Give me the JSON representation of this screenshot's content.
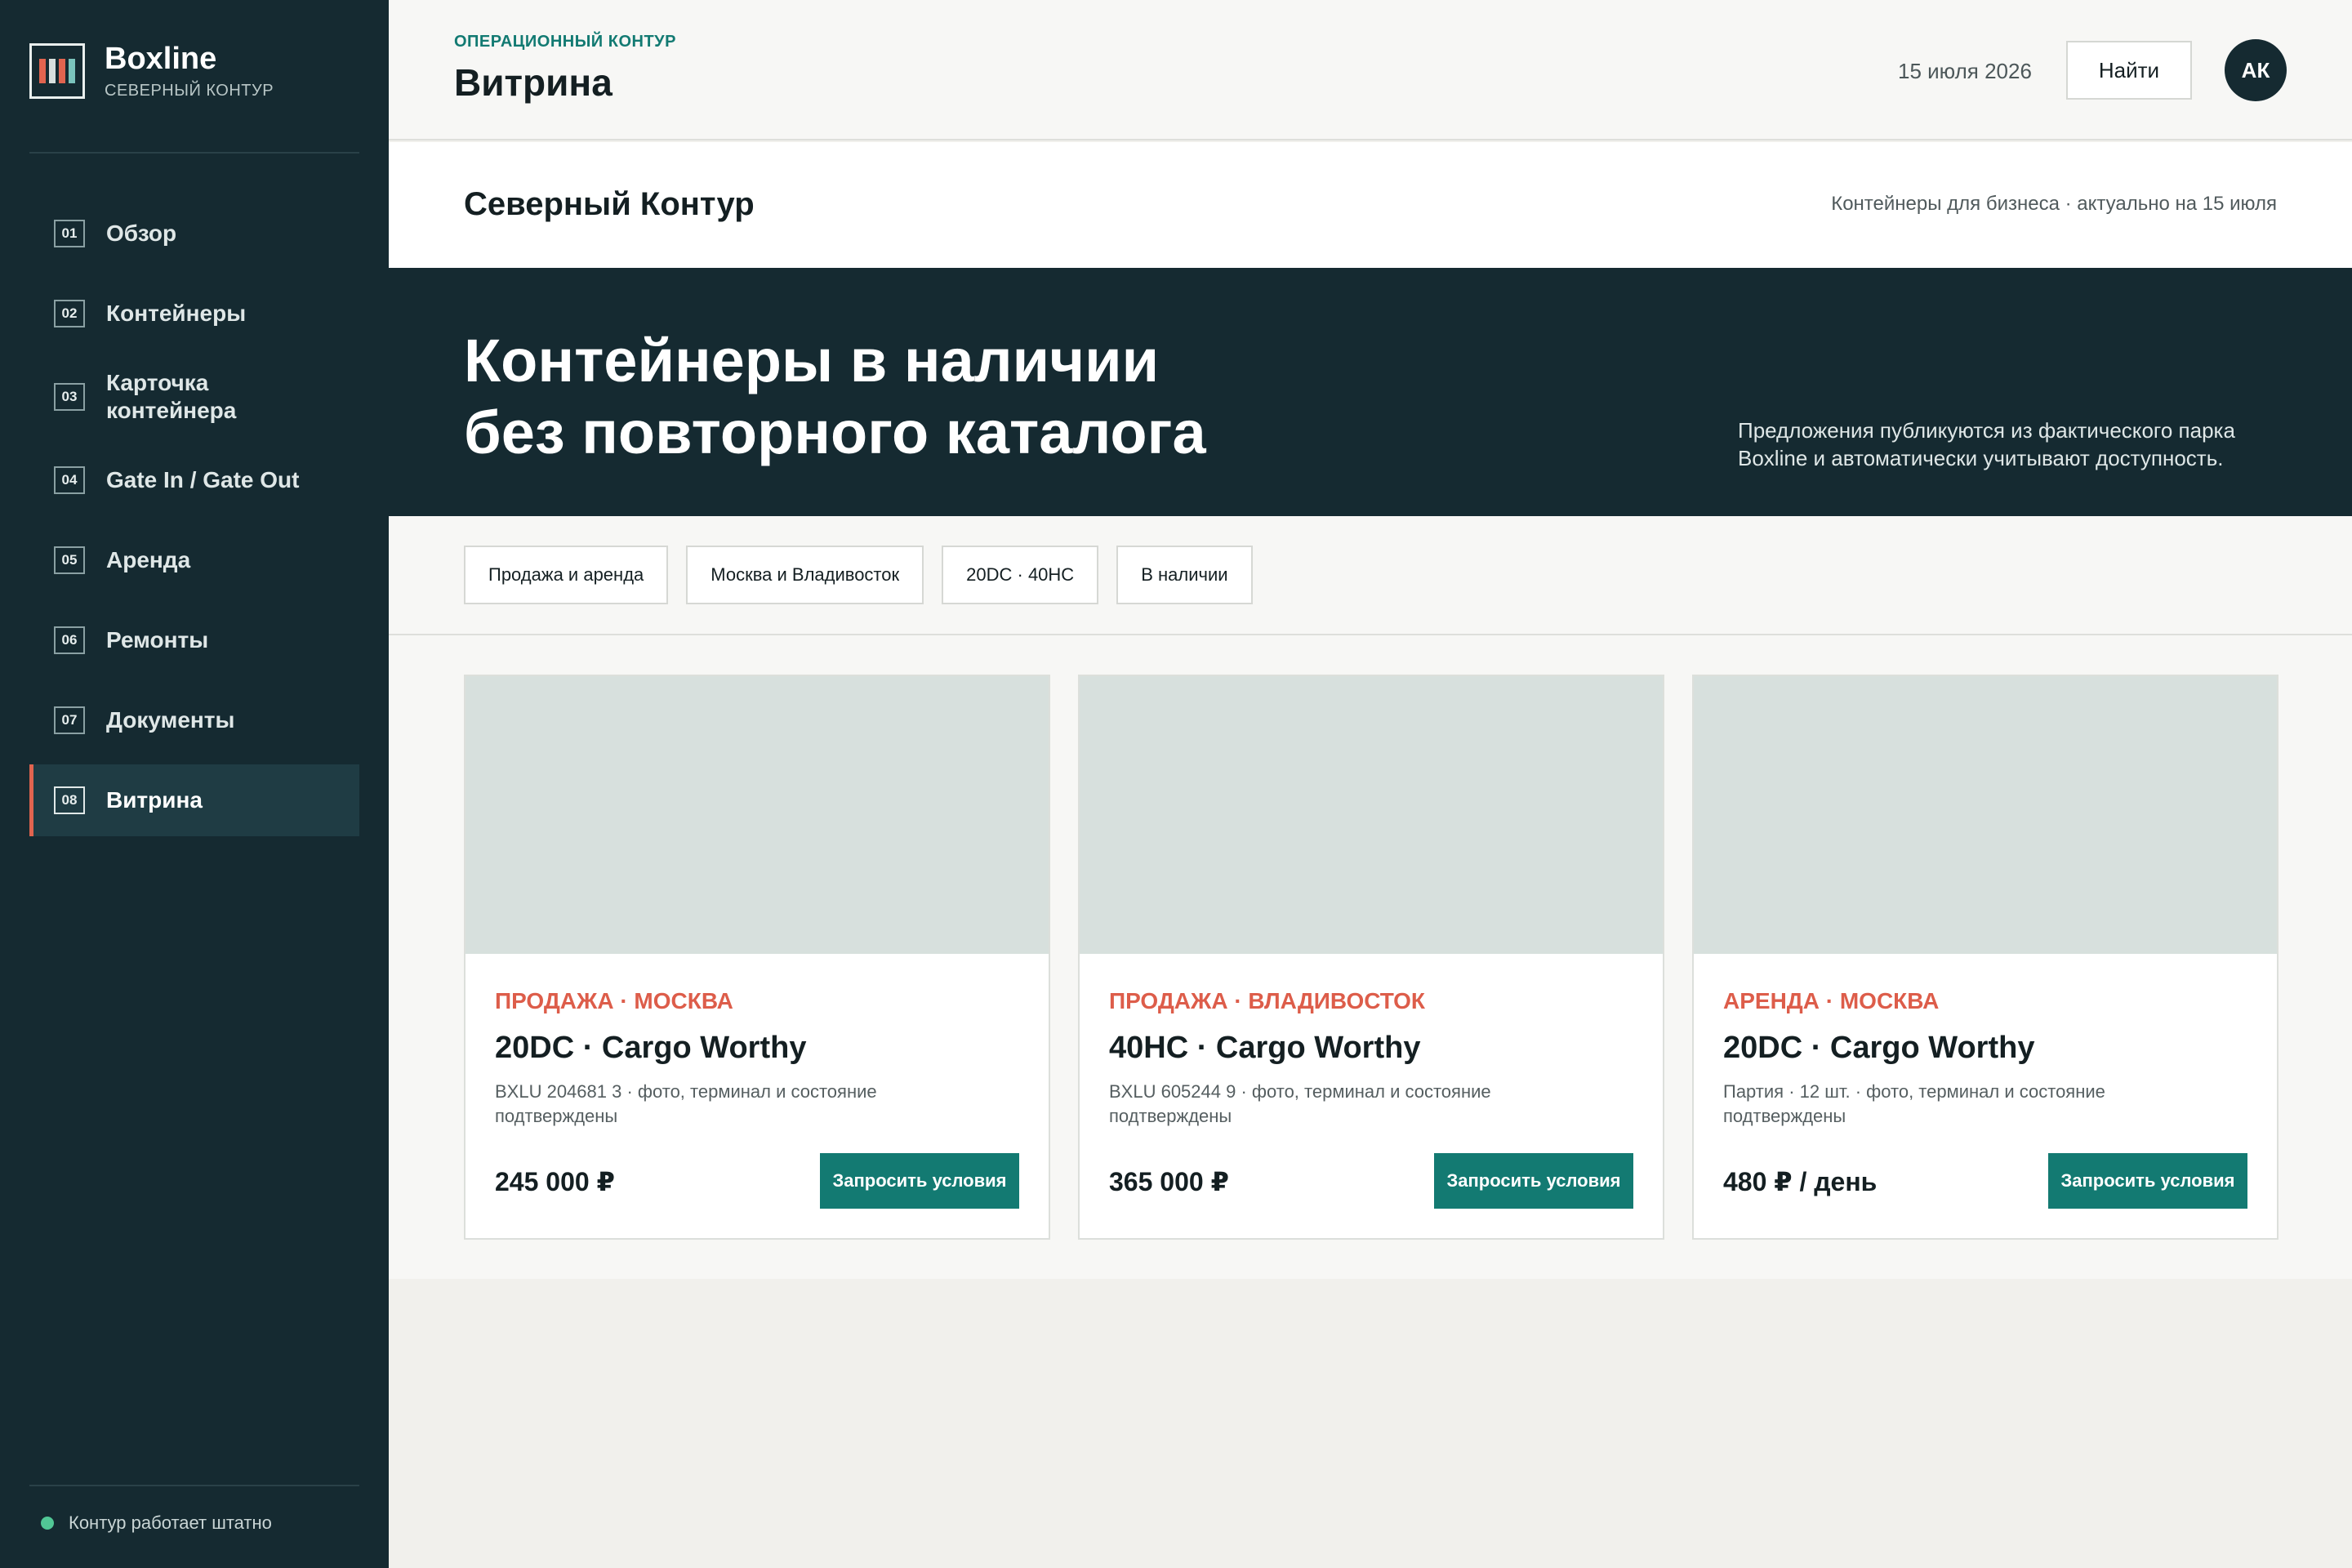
{
  "brand": {
    "name": "Boxline",
    "subtitle": "СЕВЕРНЫЙ КОНТУР"
  },
  "sidebar": {
    "items": [
      {
        "num": "01",
        "label": "Обзор"
      },
      {
        "num": "02",
        "label": "Контейнеры"
      },
      {
        "num": "03",
        "label": "Карточка контейнера"
      },
      {
        "num": "04",
        "label": "Gate In / Gate Out"
      },
      {
        "num": "05",
        "label": "Аренда"
      },
      {
        "num": "06",
        "label": "Ремонты"
      },
      {
        "num": "07",
        "label": "Документы"
      },
      {
        "num": "08",
        "label": "Витрина"
      }
    ],
    "active_index": 7,
    "status_text": "Контур работает штатно",
    "status_color": "#51c795"
  },
  "header": {
    "eyebrow": "ОПЕРАЦИОННЫЙ КОНТУР",
    "title": "Витрина",
    "date": "15 июля 2026",
    "search_label": "Найти",
    "avatar_initials": "АК"
  },
  "company": {
    "name": "Северный Контур",
    "meta": "Контейнеры для бизнеса · актуально на 15 июля"
  },
  "hero": {
    "title_line1": "Контейнеры в наличии",
    "title_line2": "без повторного каталога",
    "description": "Предложения публикуются из фактического парка Boxline и автоматически учитывают доступность."
  },
  "filters": [
    "Продажа и аренда",
    "Москва и Владивосток",
    "20DC · 40HC",
    "В наличии"
  ],
  "cards": [
    {
      "tag": "ПРОДАЖА · МОСКВА",
      "title": "20DC · Cargo Worthy",
      "description": "BXLU 204681 3 · фото, терминал и состояние подтверждены",
      "price": "245 000 ₽",
      "button": "Запросить условия"
    },
    {
      "tag": "ПРОДАЖА · ВЛАДИВОСТОК",
      "title": "40HC · Cargo Worthy",
      "description": "BXLU 605244 9 · фото, терминал и состояние подтверждены",
      "price": "365 000 ₽",
      "button": "Запросить условия"
    },
    {
      "tag": "АРЕНДА · МОСКВА",
      "title": "20DC · Cargo Worthy",
      "description": "Партия · 12 шт. · фото, терминал и состояние подтверждены",
      "price": "480 ₽ / день",
      "button": "Запросить условия"
    }
  ],
  "colors": {
    "sidebar_bg": "#152a31",
    "accent": "#137a72",
    "tag": "#dd5d4a",
    "active_marker": "#e1644f"
  }
}
